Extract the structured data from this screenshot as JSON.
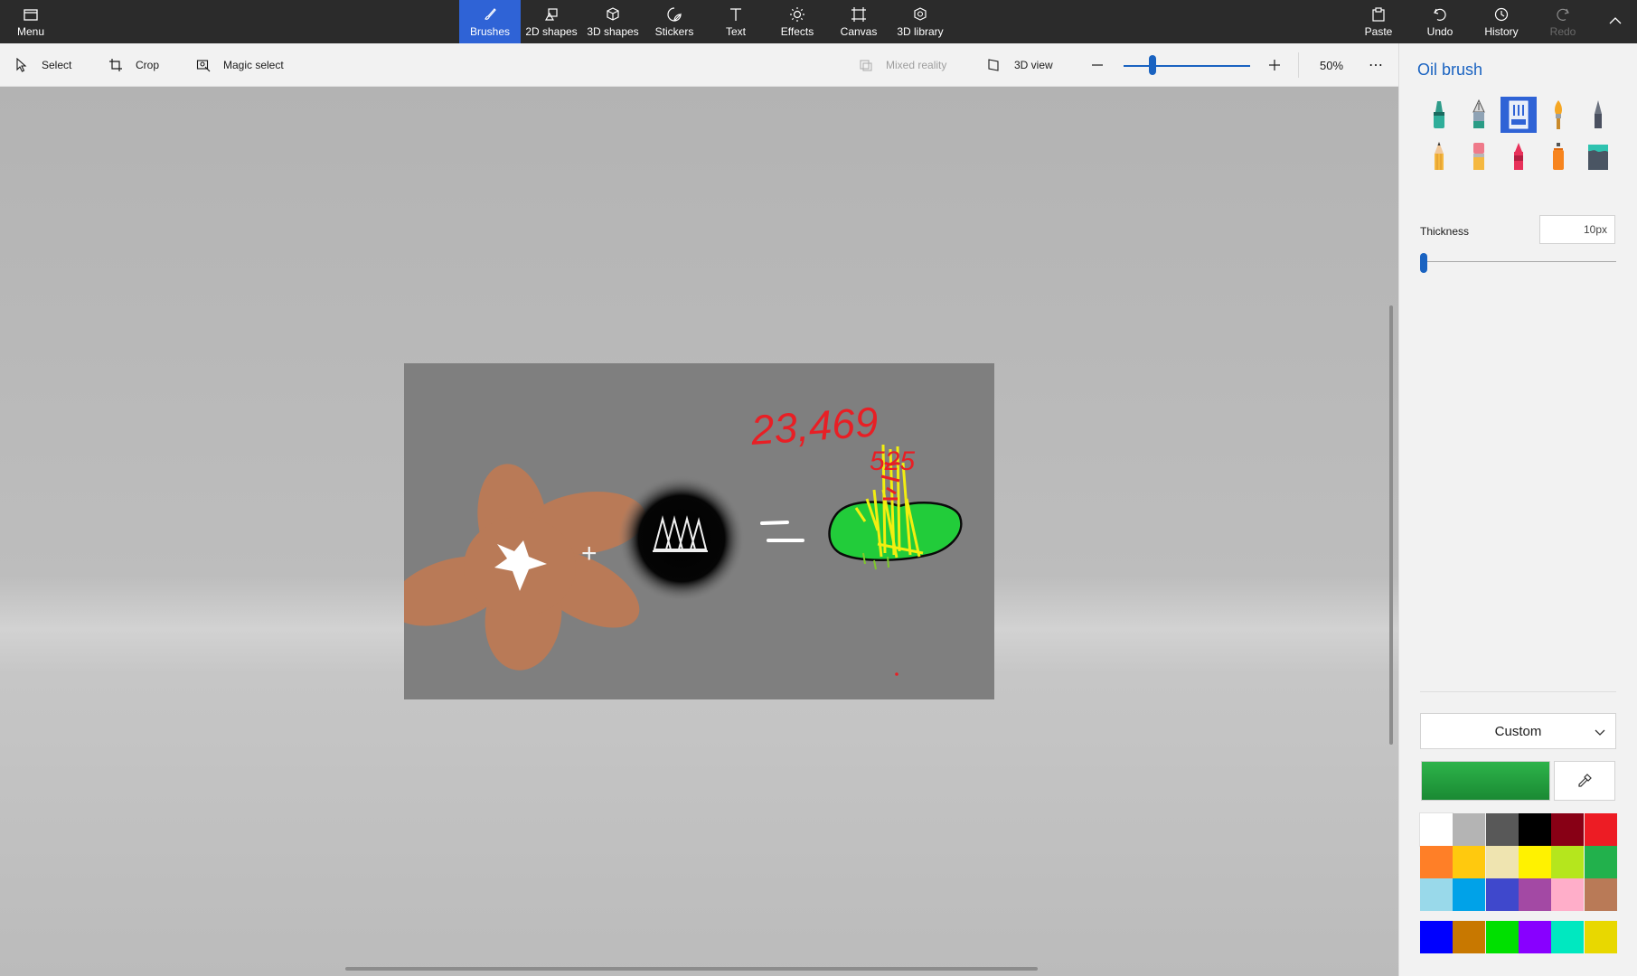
{
  "ribbon": {
    "menu_label": "Menu",
    "tabs": [
      {
        "label": "Brushes"
      },
      {
        "label": "2D shapes"
      },
      {
        "label": "3D shapes"
      },
      {
        "label": "Stickers"
      },
      {
        "label": "Text"
      },
      {
        "label": "Effects"
      },
      {
        "label": "Canvas"
      },
      {
        "label": "3D library"
      }
    ],
    "actions": {
      "paste": "Paste",
      "undo": "Undo",
      "history": "History",
      "redo": "Redo"
    }
  },
  "toolbar": {
    "select": "Select",
    "crop": "Crop",
    "magic_select": "Magic select",
    "mixed_reality": "Mixed reality",
    "view_3d": "3D view",
    "zoom_level": "50%",
    "zoom_fraction": 0.25
  },
  "canvas_art": {
    "numbers_text": "23,469",
    "numbers_text_2": "525",
    "plus_sign": "+",
    "equals_sign": "="
  },
  "panel": {
    "title": "Oil brush",
    "brushes": [
      {
        "name": "Marker",
        "icon": "marker-icon",
        "selected": false
      },
      {
        "name": "Calligraphy pen",
        "icon": "calligraphy-pen-icon",
        "selected": false
      },
      {
        "name": "Oil brush",
        "icon": "oil-brush-icon",
        "selected": true
      },
      {
        "name": "Watercolor",
        "icon": "watercolor-icon",
        "selected": false
      },
      {
        "name": "Pixel pen",
        "icon": "pixel-pen-icon",
        "selected": false
      },
      {
        "name": "Pencil",
        "icon": "pencil-icon",
        "selected": false
      },
      {
        "name": "Eraser",
        "icon": "eraser-icon",
        "selected": false
      },
      {
        "name": "Crayon",
        "icon": "crayon-icon",
        "selected": false
      },
      {
        "name": "Spray can",
        "icon": "spray-can-icon",
        "selected": false
      },
      {
        "name": "Fill",
        "icon": "fill-bucket-icon",
        "selected": false
      }
    ],
    "thickness_label": "Thickness",
    "thickness_value": "10px",
    "thickness_fraction": 0.0,
    "color_mode": "Custom",
    "current_color": "#2db34a",
    "palette": [
      "#ffffff",
      "#b4b4b4",
      "#585858",
      "#000000",
      "#880015",
      "#ed1c24",
      "#ff7f27",
      "#ffc90e",
      "#efe4b0",
      "#fff200",
      "#b5e61d",
      "#22b14c",
      "#99d9ea",
      "#00a2e8",
      "#3f48cc",
      "#a349a4",
      "#ffaec9",
      "#b97a57"
    ],
    "custom_colors": [
      "#0000ff",
      "#c87800",
      "#00e000",
      "#8800ff",
      "#00e8c0",
      "#e8d800"
    ]
  }
}
